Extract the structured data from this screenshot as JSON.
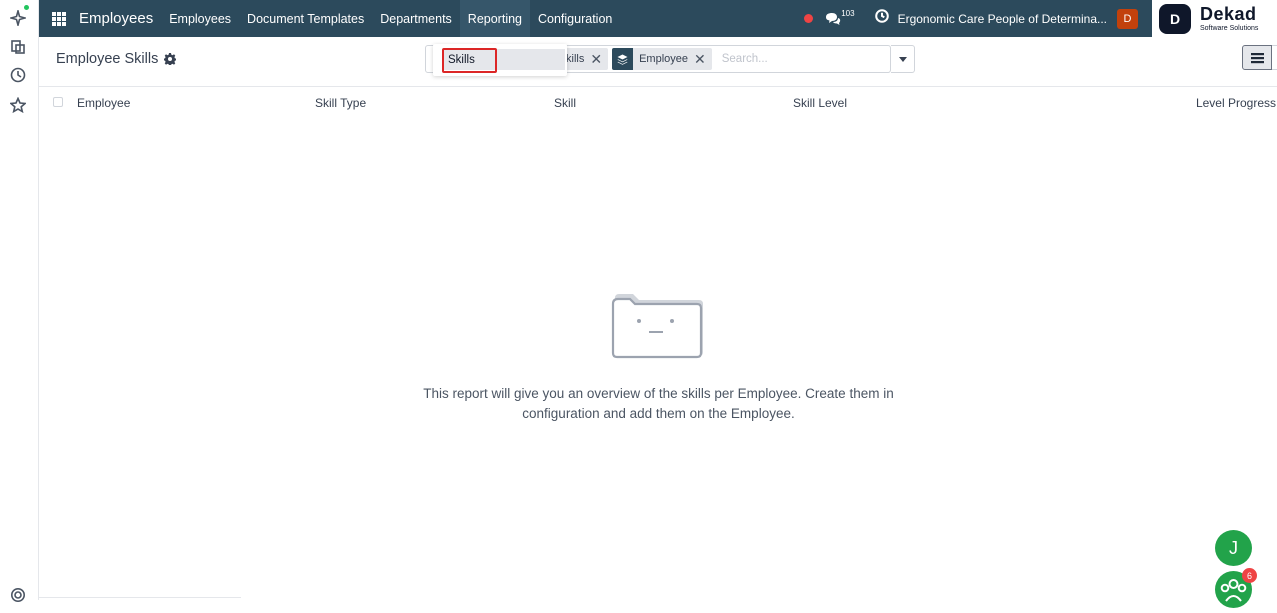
{
  "topbar": {
    "app_name": "Employees",
    "menu": [
      "Employees",
      "Document Templates",
      "Departments",
      "Reporting",
      "Configuration"
    ],
    "active_menu": "Reporting",
    "message_count": "103",
    "company": "Ergonomic Care People of Determina...",
    "user_initial": "D"
  },
  "brand": {
    "logo_letter": "D",
    "name": "Dekad",
    "tagline": "Software Solutions"
  },
  "control": {
    "breadcrumb": "Employee Skills",
    "facets": [
      {
        "label": "kills",
        "icon": "filter-icon"
      },
      {
        "label": "Employee",
        "icon": "layers-icon"
      }
    ],
    "search_placeholder": "Search...",
    "dropdown_item": "Skills"
  },
  "table": {
    "columns": [
      "Employee",
      "Skill Type",
      "Skill",
      "Skill Level",
      "Level Progress"
    ]
  },
  "empty_state": {
    "message": "This report will give you an overview of the skills per Employee. Create them in configuration and add them on the Employee."
  },
  "chat": {
    "user_initial": "J",
    "team_badge": "6"
  },
  "colors": {
    "topbar": "#2c4a5c",
    "accent_green": "#22a34a",
    "highlight_red": "#dc2626"
  }
}
